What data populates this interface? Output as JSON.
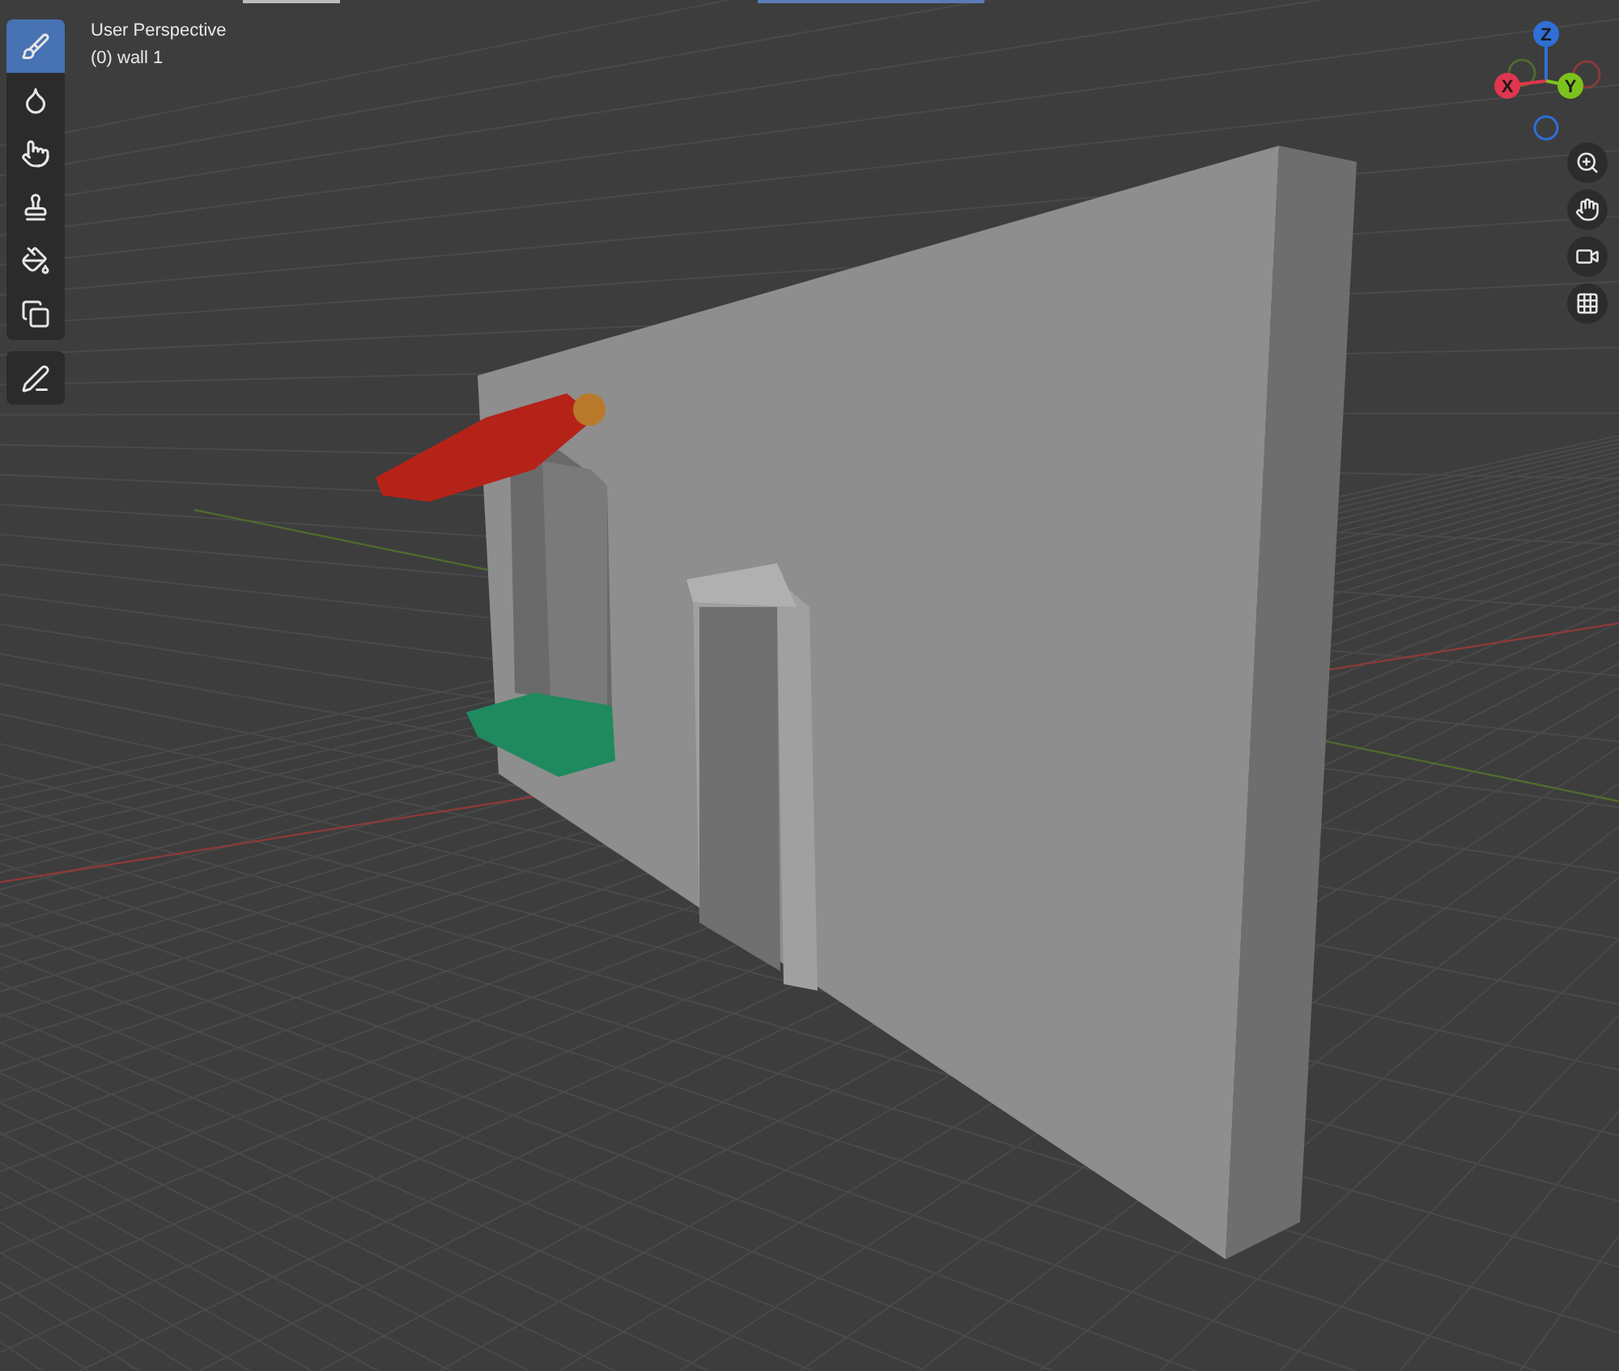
{
  "viewport": {
    "view_name": "User Perspective",
    "object_label": "(0) wall 1"
  },
  "tools": [
    {
      "kind": "brush",
      "selected": true
    },
    {
      "kind": "blur",
      "selected": false
    },
    {
      "kind": "smear",
      "selected": false
    },
    {
      "kind": "clone",
      "selected": false
    },
    {
      "kind": "fill",
      "selected": false
    },
    {
      "kind": "mask",
      "selected": false
    }
  ],
  "annotate_tool": {
    "selected": false
  },
  "gizmo": {
    "axes": [
      {
        "label": "Z",
        "color": "#2f6fd6"
      },
      {
        "label": "X",
        "color": "#e0364f"
      },
      {
        "label": "Y",
        "color": "#7dc11c"
      }
    ]
  },
  "navigation": [
    {
      "kind": "zoom"
    },
    {
      "kind": "pan"
    },
    {
      "kind": "camera"
    },
    {
      "kind": "ortho"
    }
  ]
}
